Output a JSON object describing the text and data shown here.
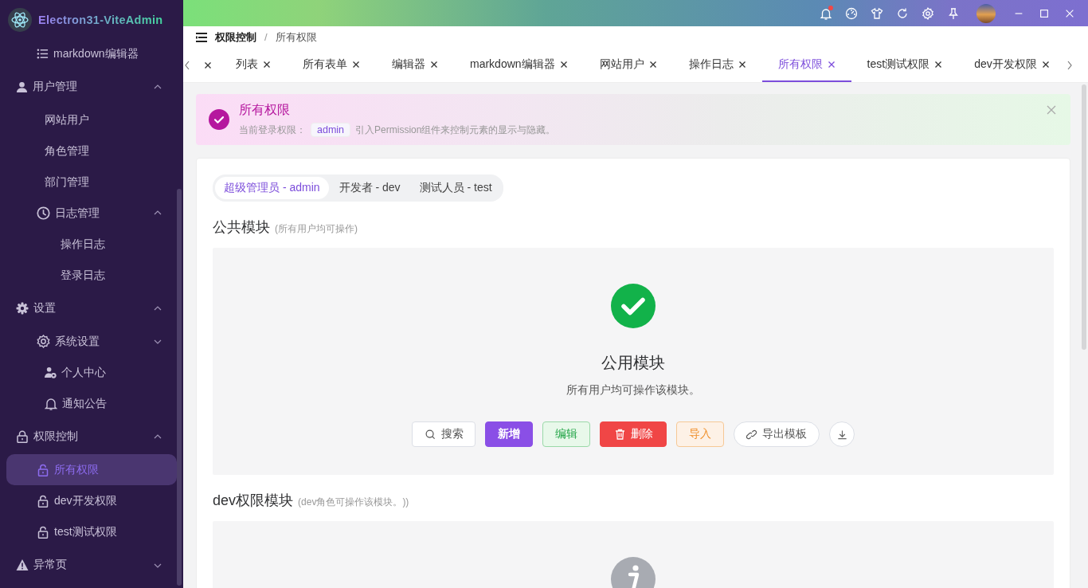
{
  "app": {
    "name": "Electron31-ViteAdmin"
  },
  "sidebar": {
    "continued_items": [
      {
        "label": "markdown编辑器",
        "selected": false
      }
    ],
    "items": [
      {
        "label": "用户管理",
        "expanded": true,
        "selected": false,
        "children": [
          {
            "label": "网站用户",
            "selected": false
          },
          {
            "label": "角色管理",
            "selected": false
          },
          {
            "label": "部门管理",
            "selected": false
          },
          {
            "label": "日志管理",
            "expanded": true,
            "selected": false,
            "children": [
              {
                "label": "操作日志",
                "selected": false
              },
              {
                "label": "登录日志",
                "selected": false
              }
            ]
          }
        ]
      },
      {
        "label": "设置",
        "expanded": true,
        "selected": false,
        "children": [
          {
            "label": "系统设置",
            "expanded": false,
            "selected": false
          },
          {
            "label": "个人中心",
            "selected": false
          },
          {
            "label": "通知公告",
            "selected": false
          }
        ]
      },
      {
        "label": "权限控制",
        "expanded": true,
        "selected": false,
        "children": [
          {
            "label": "所有权限",
            "selected": true
          },
          {
            "label": "dev开发权限",
            "selected": false
          },
          {
            "label": "test测试权限",
            "selected": false
          }
        ]
      },
      {
        "label": "异常页",
        "expanded": false,
        "selected": false
      }
    ]
  },
  "header": {
    "unread_notifications": true
  },
  "breadcrumb": {
    "separator": "/",
    "items": [
      {
        "label": "权限控制"
      },
      {
        "label": "所有权限"
      }
    ]
  },
  "tabs": {
    "clipped_first": true,
    "items": [
      {
        "label": "列表",
        "selected": false
      },
      {
        "label": "所有表单",
        "selected": false
      },
      {
        "label": "编辑器",
        "selected": false
      },
      {
        "label": "markdown编辑器",
        "selected": false
      },
      {
        "label": "网站用户",
        "selected": false
      },
      {
        "label": "操作日志",
        "selected": false
      },
      {
        "label": "所有权限",
        "selected": true
      },
      {
        "label": "test测试权限",
        "selected": false
      },
      {
        "label": "dev开发权限",
        "selected": false
      }
    ]
  },
  "alert": {
    "title": "所有权限",
    "label": "当前登录权限：",
    "role_tag": "admin",
    "text": "引入Permission组件来控制元素的显示与隐藏。"
  },
  "roles": [
    {
      "label": "超级管理员 - admin",
      "selected": true
    },
    {
      "label": "开发者 - dev",
      "selected": false
    },
    {
      "label": "测试人员 - test",
      "selected": false
    }
  ],
  "sections": [
    {
      "title": "公共模块",
      "note": "(所有用户均可操作)",
      "result": {
        "kind": "success",
        "title": "公用模块",
        "subtitle": "所有用户均可操作该模块。",
        "buttons": [
          {
            "kind": "search",
            "label": "搜索"
          },
          {
            "kind": "primary",
            "label": "新增"
          },
          {
            "kind": "success",
            "label": "编辑"
          },
          {
            "kind": "danger",
            "label": "删除"
          },
          {
            "kind": "warning",
            "label": "导入"
          },
          {
            "kind": "link",
            "label": "导出模板"
          },
          {
            "kind": "download"
          }
        ]
      }
    },
    {
      "title": "dev权限模块",
      "note": "(dev角色可操作该模块。))",
      "result": {
        "kind": "info"
      }
    }
  ]
}
